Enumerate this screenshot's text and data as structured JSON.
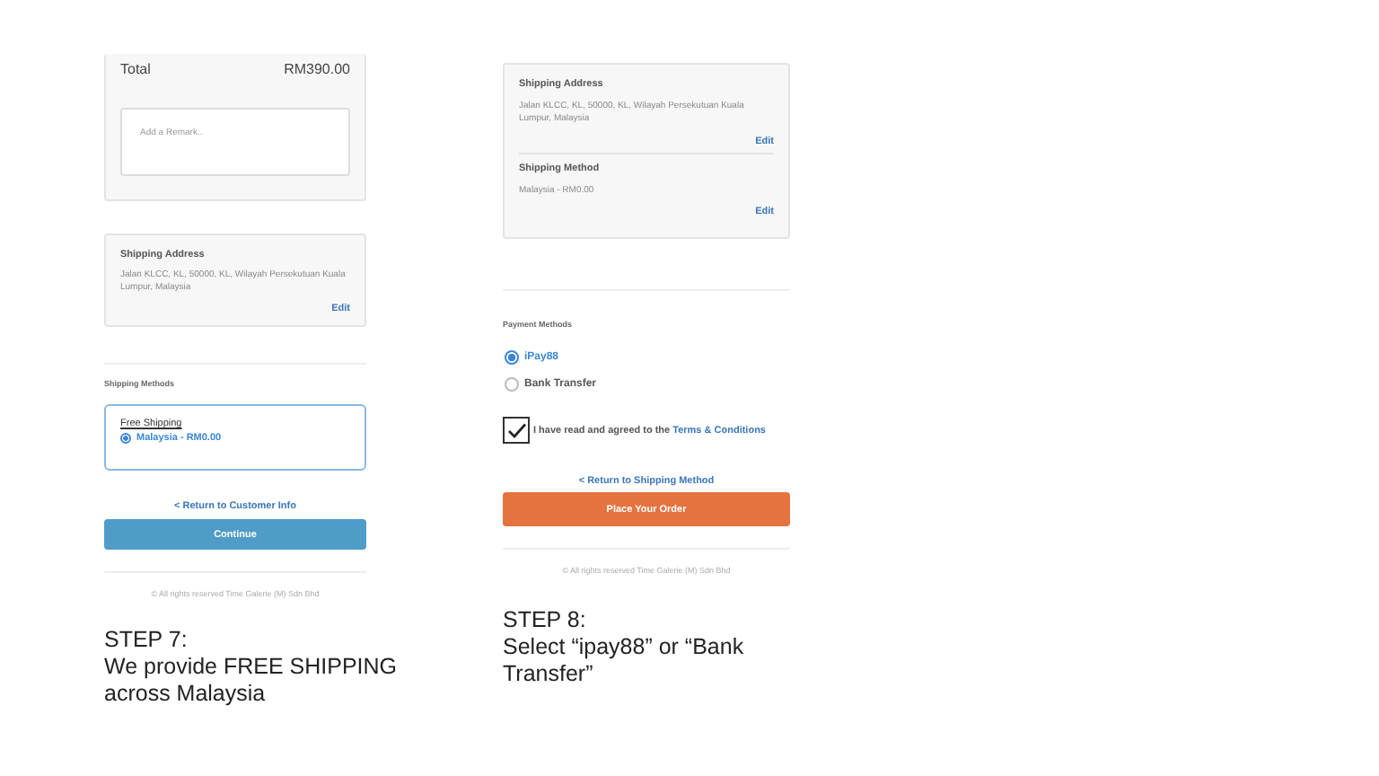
{
  "shipping_step": {
    "total": {
      "label": "Total",
      "amount": "RM390.00"
    },
    "remark": {
      "placeholder": "Add a Remark.."
    },
    "address": {
      "title": "Shipping Address",
      "text": "Jalan KLCC, KL, 50000, KL, Wilayah Persekutuan Kuala Lumpur, Malaysia",
      "edit": "Edit"
    },
    "section_title": "Shipping Methods",
    "method_group": "Free Shipping",
    "methods": [
      {
        "label": "Malaysia - RM0.00",
        "selected": true
      }
    ],
    "back_link": "< Return to Customer Info",
    "button": "Continue",
    "footer": "© All rights reserved Time Galerie (M) Sdn Bhd",
    "caption": {
      "title": "STEP 7:",
      "text": "We provide FREE SHIPPING across Malaysia"
    }
  },
  "payment_step": {
    "summary": [
      {
        "title": "Shipping Address",
        "text": "Jalan KLCC, KL, 50000, KL, Wilayah Persekutuan Kuala Lumpur, Malaysia",
        "edit": "Edit"
      },
      {
        "title": "Shipping Method",
        "text": "Malaysia - RM0.00",
        "edit": "Edit"
      }
    ],
    "section_title": "Payment Methods",
    "methods": [
      {
        "label": "iPay88",
        "selected": true
      },
      {
        "label": "Bank Transfer",
        "selected": false
      }
    ],
    "agreement": {
      "checked": true,
      "text": "I have read and agreed to the",
      "link": "Terms & Conditions"
    },
    "back_link": "< Return to Shipping Method",
    "button": "Place Your Order",
    "footer": "© All rights reserved Time Galerie (M) Sdn Bhd",
    "caption": {
      "title": "STEP 8:",
      "text": "Select “ipay88” or “Bank Transfer”"
    }
  }
}
